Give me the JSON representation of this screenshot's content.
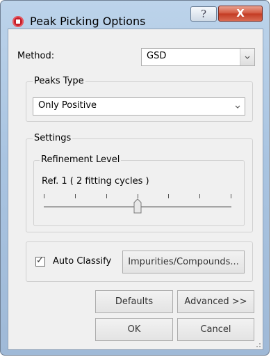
{
  "window": {
    "title": "Peak Picking Options",
    "help_label": "?",
    "close_label": "X"
  },
  "method": {
    "label": "Method:",
    "value": "GSD"
  },
  "peaks_type": {
    "legend": "Peaks Type",
    "value": "Only Positive"
  },
  "settings": {
    "legend": "Settings",
    "refinement": {
      "legend": "Refinement Level",
      "value_text": "Ref. 1 ( 2 fitting cycles )",
      "slider_level": 3,
      "slider_ticks": 7
    }
  },
  "auto_classify": {
    "label": "Auto Classify",
    "checked": true,
    "check_mark": "✓",
    "impurities_button": "Impurities/Compounds..."
  },
  "buttons": {
    "defaults": "Defaults",
    "advanced": "Advanced >>",
    "ok": "OK",
    "cancel": "Cancel"
  },
  "colors": {
    "title_bar": "#a9c4e1",
    "close_button": "#c23a22",
    "app_icon": "#c4202b"
  }
}
